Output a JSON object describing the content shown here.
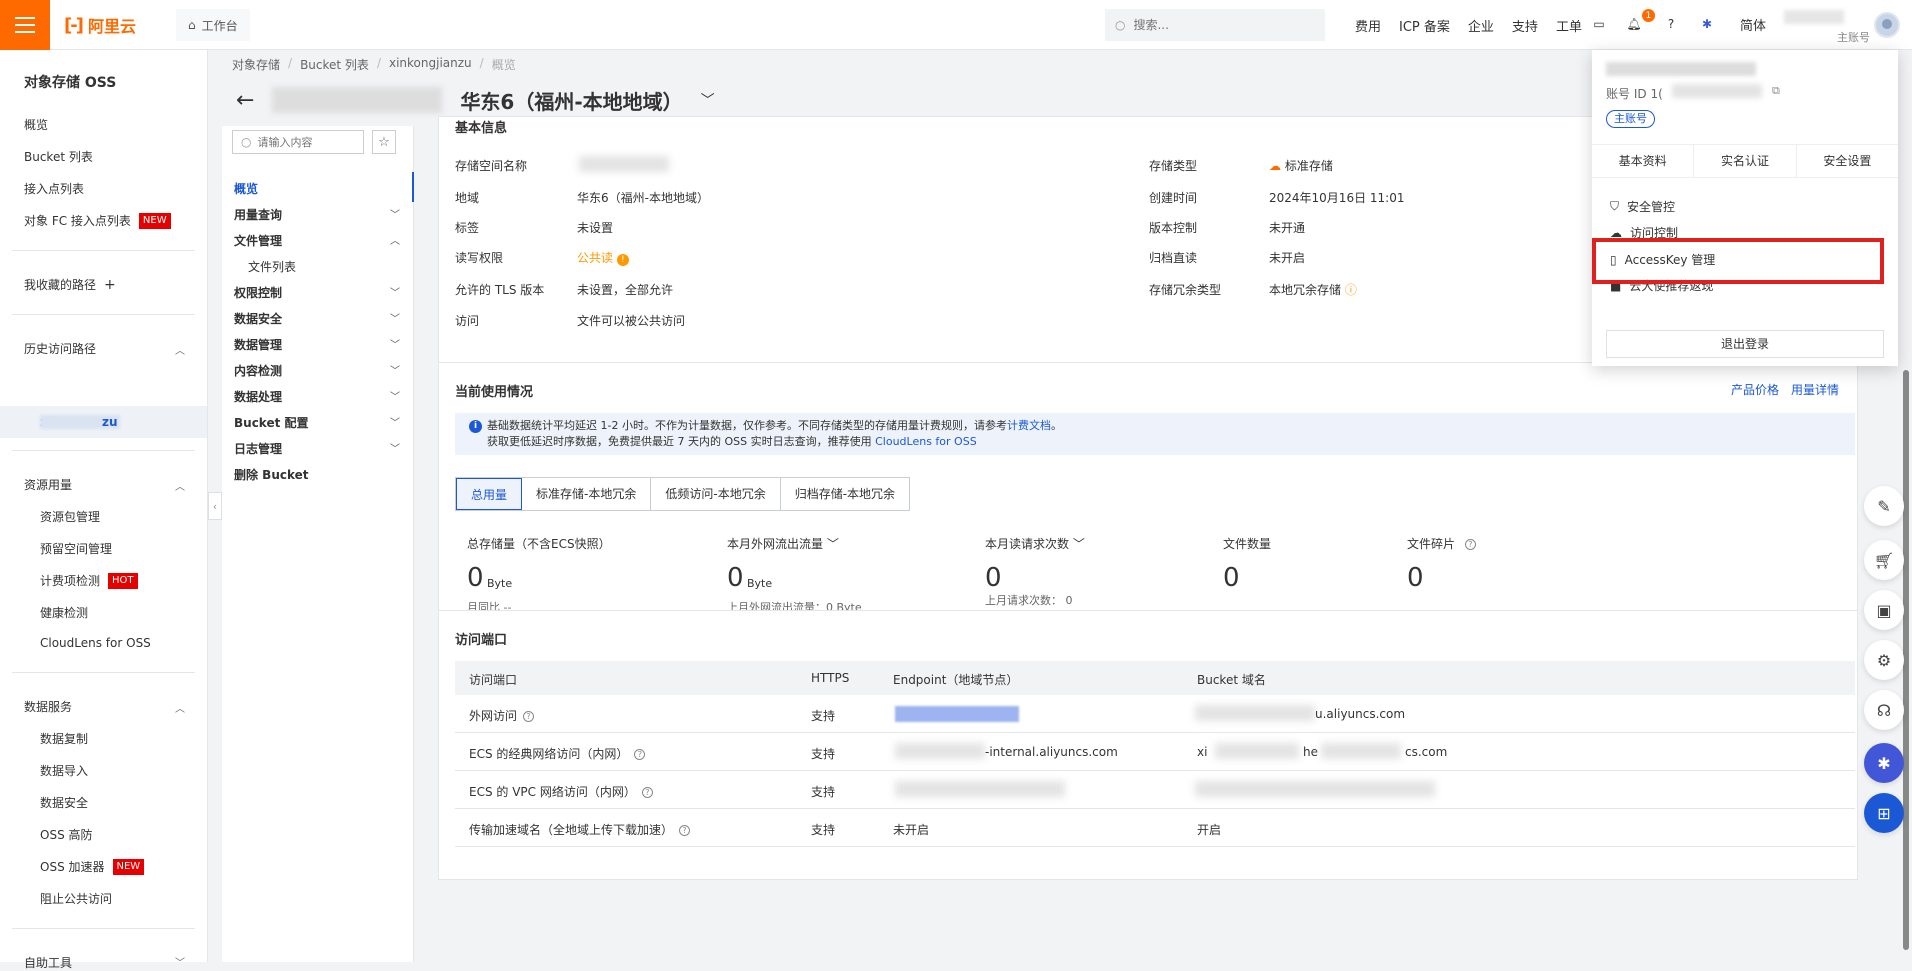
{
  "topbar": {
    "logo_text": "阿里云",
    "workbench": "工作台",
    "search_placeholder": "搜索...",
    "nav": [
      "费用",
      "ICP 备案",
      "企业",
      "支持",
      "工单"
    ],
    "notif_count": "1",
    "lang": "简体",
    "account_sub": "主账号"
  },
  "side1": {
    "title": "对象存储 OSS",
    "items": [
      "概览",
      "Bucket 列表",
      "接入点列表",
      "对象 FC 接入点列表"
    ],
    "new_tag": "NEW",
    "hot_tag": "HOT",
    "fav": "我收藏的路径",
    "history": "历史访问路径",
    "history_item_prefix": "xi",
    "history_item_suffix": "zu",
    "resource": "资源用量",
    "resource_items": [
      "资源包管理",
      "预留空间管理",
      "计费项检测",
      "健康检测",
      "CloudLens for OSS"
    ],
    "data_service": "数据服务",
    "data_items": [
      "数据复制",
      "数据导入",
      "数据安全",
      "OSS 高防",
      "OSS 加速器",
      "阻止公共访问"
    ],
    "self_tools": "自助工具"
  },
  "breadcrumb": [
    "对象存储",
    "Bucket 列表",
    "xinkongjianzu",
    "概览"
  ],
  "page_title": "华东6（福州-本地地域）",
  "side2": {
    "search_placeholder": "请输入内容",
    "items": [
      "概览",
      "用量查询",
      "文件管理",
      "权限控制",
      "数据安全",
      "数据管理",
      "内容检测",
      "数据处理",
      "Bucket 配置",
      "日志管理",
      "删除 Bucket"
    ],
    "sub_item": "文件列表"
  },
  "basic_info": {
    "title": "基本信息",
    "left": [
      {
        "k": "存储空间名称",
        "v": ""
      },
      {
        "k": "地域",
        "v": "华东6（福州-本地地域）"
      },
      {
        "k": "标签",
        "v": "未设置"
      },
      {
        "k": "读写权限",
        "v": "公共读"
      },
      {
        "k": "允许的 TLS 版本",
        "v": "未设置，全部允许"
      },
      {
        "k": "访问",
        "v": "文件可以被公共访问"
      }
    ],
    "right": [
      {
        "k": "存储类型",
        "v": "标准存储"
      },
      {
        "k": "创建时间",
        "v": "2024年10月16日 11:01"
      },
      {
        "k": "版本控制",
        "v": "未开通"
      },
      {
        "k": "归档直读",
        "v": "未开启"
      },
      {
        "k": "存储冗余类型",
        "v": "本地冗余存储"
      }
    ]
  },
  "usage": {
    "title": "当前使用情况",
    "links": [
      "产品价格",
      "用量详情"
    ],
    "notice_line1": "基础数据统计平均延迟 1-2 小时。不作为计量数据，仅作参考。不同存储类型的存储用量计费规则，请参考",
    "notice_link1": "计费文档",
    "notice_end1": "。",
    "notice_line2": "获取更低延迟时序数据，免费提供最近 7 天内的 OSS 实时日志查询，推荐使用",
    "notice_link2": "CloudLens for OSS",
    "tabs": [
      "总用量",
      "标准存储-本地冗余",
      "低频访问-本地冗余",
      "归档存储-本地冗余"
    ],
    "stats": [
      {
        "label": "总存储量（不含ECS快照）",
        "value": "0",
        "unit": "Byte",
        "sub": "月同比 --"
      },
      {
        "label": "本月外网流出流量",
        "value": "0",
        "unit": "Byte",
        "sub": "上月外网流出流量：0 Byte"
      },
      {
        "label": "本月读请求次数",
        "value": "0",
        "unit": "",
        "sub": "上月请求次数： 0"
      },
      {
        "label": "文件数量",
        "value": "0",
        "unit": "",
        "sub": ""
      },
      {
        "label": "文件碎片",
        "value": "0",
        "unit": "",
        "sub": ""
      }
    ]
  },
  "endpoints": {
    "title": "访问端口",
    "headers": [
      "访问端口",
      "HTTPS",
      "Endpoint（地域节点）",
      "Bucket 域名"
    ],
    "rows": [
      {
        "name": "外网访问",
        "https": "支持",
        "endpoint": "",
        "domain": "u.aliyuncs.com"
      },
      {
        "name": "ECS 的经典网络访问（内网）",
        "https": "支持",
        "endpoint": "-internal.aliyuncs.com",
        "domain_a": "xi",
        "domain_b": "he",
        "domain": "cs.com"
      },
      {
        "name": "ECS 的 VPC 网络访问（内网）",
        "https": "支持",
        "endpoint": "",
        "domain": ""
      },
      {
        "name": "传输加速域名（全地域上传下载加速）",
        "https": "支持",
        "endpoint": "未开启",
        "domain": "开启"
      }
    ]
  },
  "account_menu": {
    "account_id_label": "账号 ID",
    "account_id_prefix": "1(",
    "main_tag": "主账号",
    "tabs": [
      "基本资料",
      "实名认证",
      "安全设置"
    ],
    "items": [
      "安全管控",
      "访问控制",
      "AccessKey 管理",
      "云大使推荐返现"
    ],
    "logout": "退出登录"
  }
}
